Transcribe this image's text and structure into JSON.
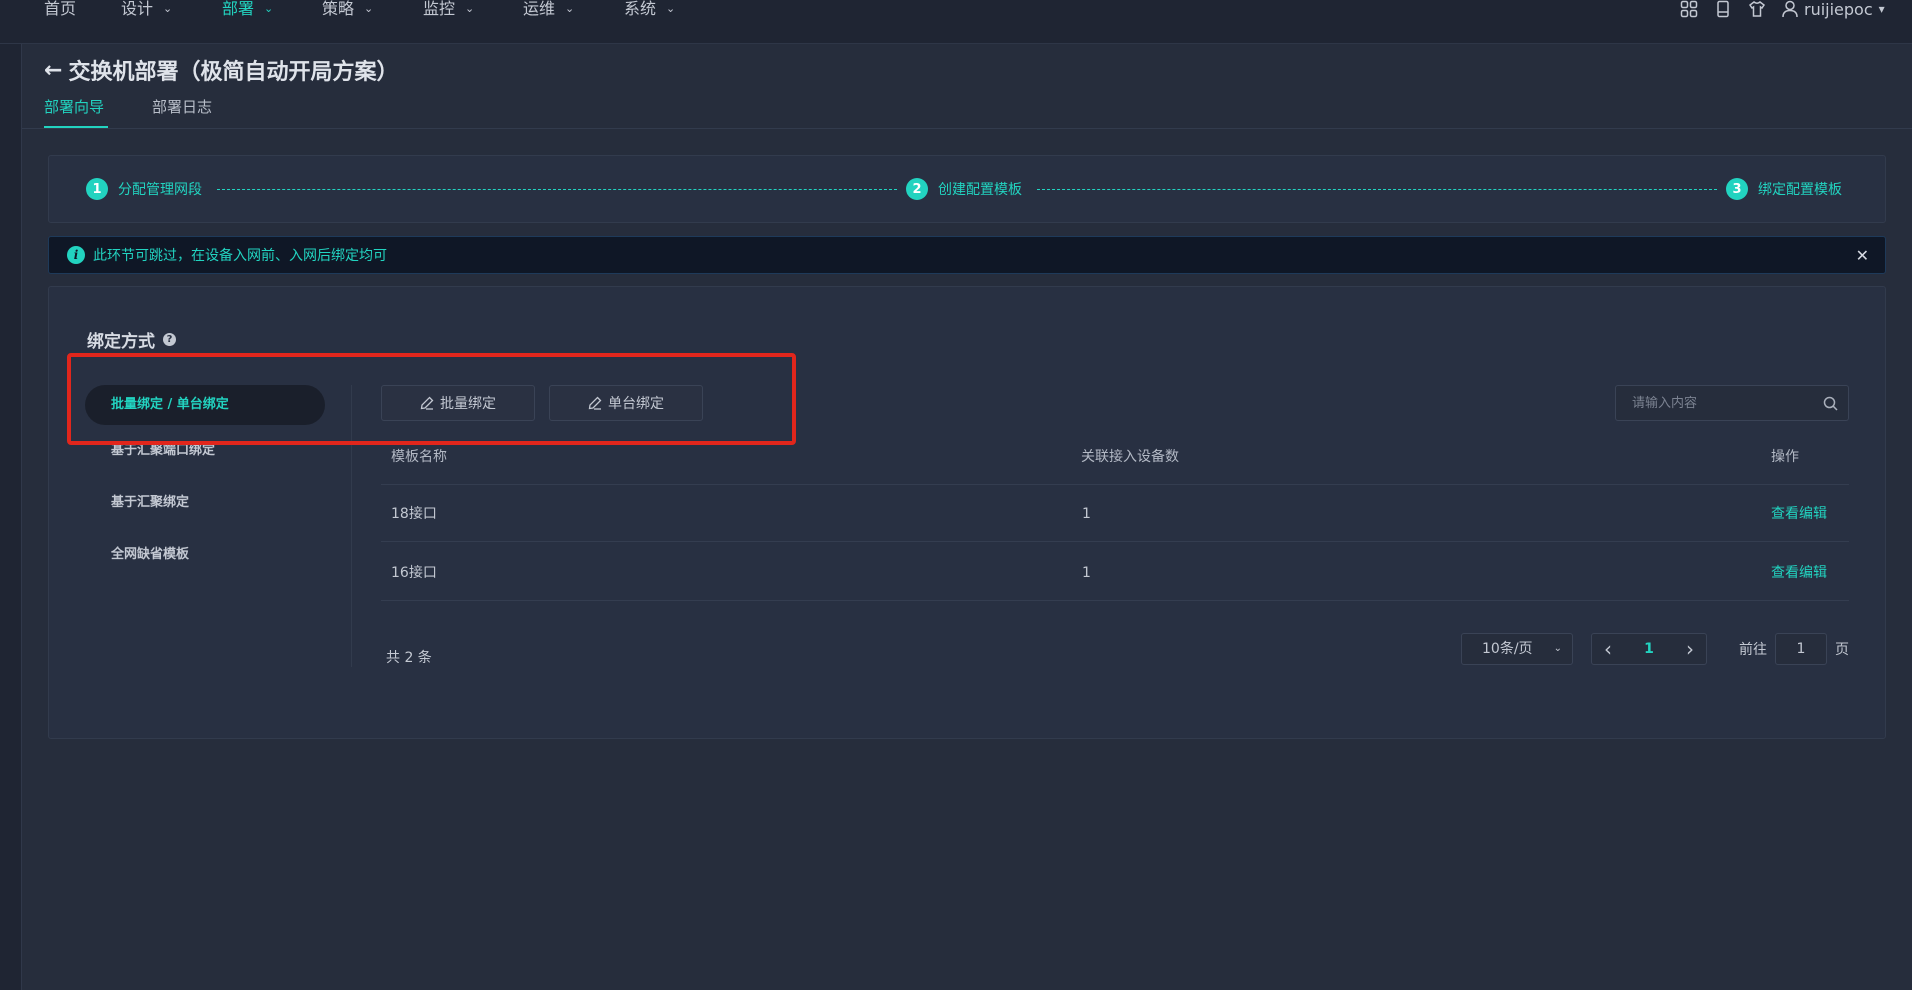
{
  "nav": {
    "items": [
      {
        "label": "首页",
        "has_chevron": false,
        "active": false
      },
      {
        "label": "设计",
        "has_chevron": true,
        "active": false
      },
      {
        "label": "部署",
        "has_chevron": true,
        "active": true
      },
      {
        "label": "策略",
        "has_chevron": true,
        "active": false
      },
      {
        "label": "监控",
        "has_chevron": true,
        "active": false
      },
      {
        "label": "运维",
        "has_chevron": true,
        "active": false
      },
      {
        "label": "系统",
        "has_chevron": true,
        "active": false
      }
    ],
    "icons": [
      "apps-grid-icon",
      "device-icon",
      "shirt-icon"
    ],
    "user": "ruijiepoc",
    "user_chevron": "▾"
  },
  "header": {
    "back": "←",
    "title": "交换机部署（极简自动开局方案）",
    "tabs": [
      "部署向导",
      "部署日志"
    ]
  },
  "steps": [
    {
      "num": "1",
      "label": "分配管理网段"
    },
    {
      "num": "2",
      "label": "创建配置模板"
    },
    {
      "num": "3",
      "label": "绑定配置模板"
    }
  ],
  "banner": {
    "icon": "i",
    "text": "此环节可跳过，在设备入网前、入网后绑定均可",
    "close": "✕"
  },
  "section": {
    "title": "绑定方式",
    "help": "?"
  },
  "side_menu": [
    {
      "label": "批量绑定 / 单台绑定",
      "active": true
    },
    {
      "label": "基于汇聚端口绑定",
      "active": false
    },
    {
      "label": "基于汇聚绑定",
      "active": false
    },
    {
      "label": "全网缺省模板",
      "active": false
    }
  ],
  "toolbar": {
    "batch_bind": "批量绑定",
    "single_bind": "单台绑定"
  },
  "search": {
    "placeholder": "请输入内容",
    "value": ""
  },
  "table": {
    "columns": [
      "模板名称",
      "关联接入设备数",
      "操作"
    ],
    "rows": [
      {
        "name": "18接口",
        "count": "1",
        "action": "查看编辑"
      },
      {
        "name": "16接口",
        "count": "1",
        "action": "查看编辑"
      }
    ]
  },
  "pagination": {
    "total": "共 2 条",
    "page_size": "10条/页",
    "prev": "‹",
    "current": "1",
    "next": "›",
    "goto_label": "前往",
    "goto_value": "1",
    "goto_suffix": "页"
  },
  "colors": {
    "accent": "#22d3c0",
    "highlight": "#e1261c"
  }
}
